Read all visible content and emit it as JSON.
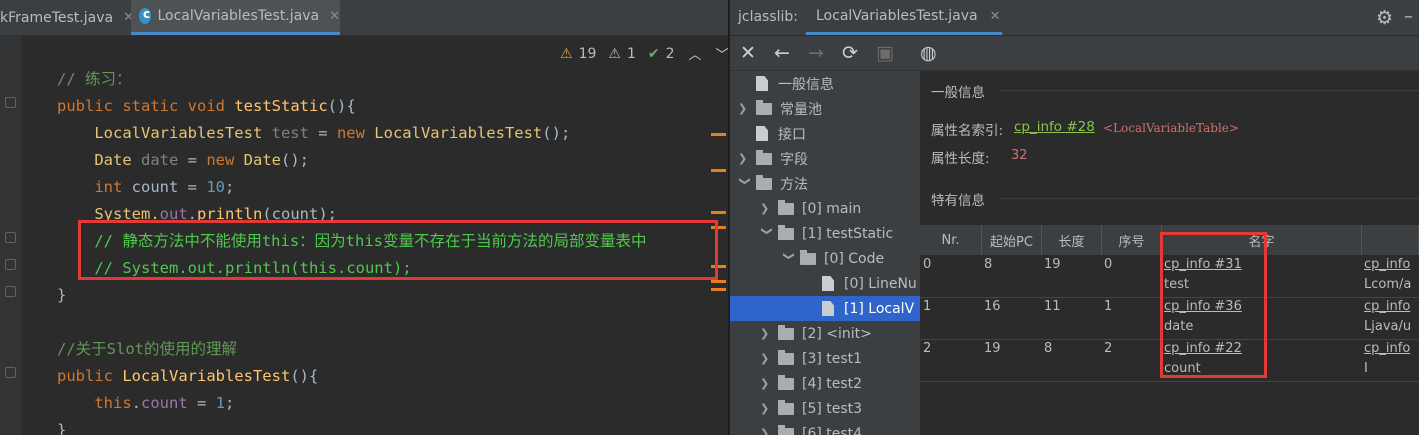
{
  "editor": {
    "tabs": [
      {
        "label": "kFrameTest.java",
        "active": false
      },
      {
        "label": "LocalVariablesTest.java",
        "active": true
      }
    ],
    "inspections": {
      "warnings": "19",
      "weak_warnings": "1",
      "typos": "2"
    },
    "lines": [
      [
        {
          "t": "// 练习：",
          "c": "cm"
        }
      ],
      [
        {
          "t": "public ",
          "c": "kw"
        },
        {
          "t": "static ",
          "c": "kw"
        },
        {
          "t": "void ",
          "c": "kw"
        },
        {
          "t": "testStatic",
          "c": "fn"
        },
        {
          "t": "(){",
          "c": "txt"
        }
      ],
      [
        {
          "t": "    LocalVariablesTest ",
          "c": "ctype"
        },
        {
          "t": "test",
          "c": "lv"
        },
        {
          "t": " = ",
          "c": "txt"
        },
        {
          "t": "new ",
          "c": "kw"
        },
        {
          "t": "LocalVariablesTest",
          "c": "ctype"
        },
        {
          "t": "();",
          "c": "txt"
        }
      ],
      [
        {
          "t": "    Date ",
          "c": "ctype"
        },
        {
          "t": "date",
          "c": "lv"
        },
        {
          "t": " = ",
          "c": "txt"
        },
        {
          "t": "new ",
          "c": "kw"
        },
        {
          "t": "Date",
          "c": "ctype"
        },
        {
          "t": "();",
          "c": "txt"
        }
      ],
      [
        {
          "t": "    int ",
          "c": "kw"
        },
        {
          "t": "count",
          "c": "txt"
        },
        {
          "t": " = ",
          "c": "txt"
        },
        {
          "t": "10",
          "c": "num"
        },
        {
          "t": ";",
          "c": "txt"
        }
      ],
      [
        {
          "t": "    System.",
          "c": "ctype"
        },
        {
          "t": "out",
          "c": "fld"
        },
        {
          "t": ".",
          "c": "txt"
        },
        {
          "t": "println",
          "c": "fn"
        },
        {
          "t": "(count);",
          "c": "txt"
        }
      ],
      [
        {
          "t": "    // 静态方法中不能使用this：因为this变量不存在于当前方法的局部变量表中",
          "c": "cmg"
        }
      ],
      [
        {
          "t": "    // System.out.println(this.count);",
          "c": "cmg"
        }
      ],
      [
        {
          "t": "}",
          "c": "txt"
        }
      ],
      [
        {
          "t": "",
          "c": "txt"
        }
      ],
      [
        {
          "t": "//关于Slot的使用的理解",
          "c": "cm"
        }
      ],
      [
        {
          "t": "public ",
          "c": "kw"
        },
        {
          "t": "LocalVariablesTest",
          "c": "fn"
        },
        {
          "t": "(){",
          "c": "txt"
        }
      ],
      [
        {
          "t": "    this",
          "c": "kw"
        },
        {
          "t": ".",
          "c": "txt"
        },
        {
          "t": "count",
          "c": "fld"
        },
        {
          "t": " = ",
          "c": "txt"
        },
        {
          "t": "1",
          "c": "num"
        },
        {
          "t": ";",
          "c": "txt"
        }
      ],
      [
        {
          "t": "}",
          "c": "txt"
        }
      ]
    ]
  },
  "jclasslib": {
    "title": "jclasslib:",
    "tab_label": "LocalVariablesTest.java",
    "tree": [
      {
        "label": "一般信息",
        "indent": 0,
        "icon": "file",
        "arrow": ""
      },
      {
        "label": "常量池",
        "indent": 0,
        "icon": "folder",
        "arrow": "›"
      },
      {
        "label": "接口",
        "indent": 0,
        "icon": "file",
        "arrow": ""
      },
      {
        "label": "字段",
        "indent": 0,
        "icon": "folder",
        "arrow": "›"
      },
      {
        "label": "方法",
        "indent": 0,
        "icon": "folder",
        "arrow": "⌄"
      },
      {
        "label": "[0] main",
        "indent": 1,
        "icon": "folder",
        "arrow": "›"
      },
      {
        "label": "[1] testStatic",
        "indent": 1,
        "icon": "folder",
        "arrow": "⌄"
      },
      {
        "label": "[0] Code",
        "indent": 2,
        "icon": "folder",
        "arrow": "⌄"
      },
      {
        "label": "[0] LineNu",
        "indent": 3,
        "icon": "file",
        "arrow": ""
      },
      {
        "label": "[1] LocalV",
        "indent": 3,
        "icon": "file",
        "arrow": "",
        "selected": true
      },
      {
        "label": "[2] <init>",
        "indent": 1,
        "icon": "folder",
        "arrow": "›"
      },
      {
        "label": "[3] test1",
        "indent": 1,
        "icon": "folder",
        "arrow": "›"
      },
      {
        "label": "[4] test2",
        "indent": 1,
        "icon": "folder",
        "arrow": "›"
      },
      {
        "label": "[5] test3",
        "indent": 1,
        "icon": "folder",
        "arrow": "›"
      },
      {
        "label": "[6] test4",
        "indent": 1,
        "icon": "folder",
        "arrow": "›"
      }
    ],
    "detail": {
      "general_section": "一般信息",
      "attr_name_label": "属性名索引:",
      "attr_name_link": "cp_info #28",
      "attr_name_tag": "<LocalVariableTable>",
      "attr_len_label": "属性长度:",
      "attr_len_value": "32",
      "specific_section": "特有信息",
      "columns": [
        "Nr.",
        "起始PC",
        "长度",
        "序号",
        "名字",
        ""
      ],
      "rows": [
        {
          "nr": "0",
          "pc": "8",
          "len": "19",
          "idx": "0",
          "name_link": "cp_info #31",
          "name": "test",
          "desc_link": "cp_info",
          "desc": "Lcom/a"
        },
        {
          "nr": "1",
          "pc": "16",
          "len": "11",
          "idx": "1",
          "name_link": "cp_info #36",
          "name": "date",
          "desc_link": "cp_info",
          "desc": "Ljava/u"
        },
        {
          "nr": "2",
          "pc": "19",
          "len": "8",
          "idx": "2",
          "name_link": "cp_info #22",
          "name": "count",
          "desc_link": "cp_info",
          "desc": "I"
        }
      ]
    }
  }
}
